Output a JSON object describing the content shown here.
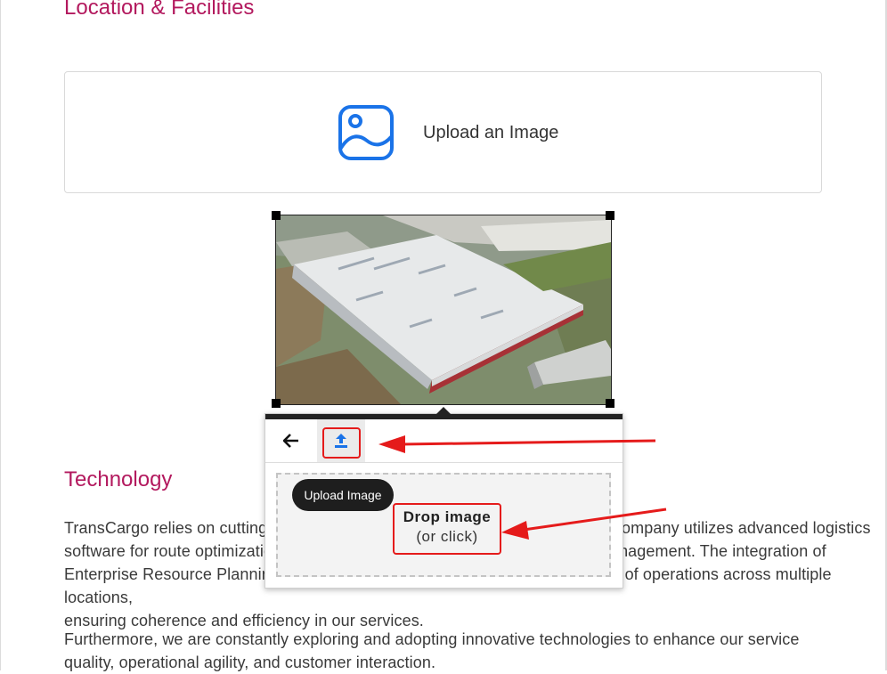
{
  "sections": {
    "location_title": "Location & Facilities",
    "technology_title": "Technology"
  },
  "upload_box": {
    "label": "Upload an Image",
    "icon": "image-icon"
  },
  "image_editor": {
    "image_alt": "Aerial view of a large warehouse facility",
    "toolbar": {
      "back_icon": "arrow-left-icon",
      "upload_icon": "upload-icon"
    },
    "tooltip": "Upload Image",
    "drop_zone": {
      "line1": "Drop image",
      "line2": "(or click)"
    }
  },
  "technology": {
    "para1": {
      "line1": "TransCargo relies on cutting-edge technologies to power its operations. The company utilizes advanced logistics",
      "line2": "software for route optimization, inventory tracking, and real-time shipment management. The integration of",
      "line3": "Enterprise Resource Planning (ERP) systems ensures seamless coordination of operations across multiple locations,",
      "line4": "ensuring coherence and efficiency in our services."
    },
    "para2": {
      "line1": "Furthermore, we are constantly exploring and adopting innovative technologies to enhance our service",
      "line2": "quality, operational agility, and customer interaction."
    }
  },
  "colors": {
    "heading": "#b3195e",
    "icon_blue": "#1a73e8",
    "annotation_red": "#e51b1b"
  }
}
